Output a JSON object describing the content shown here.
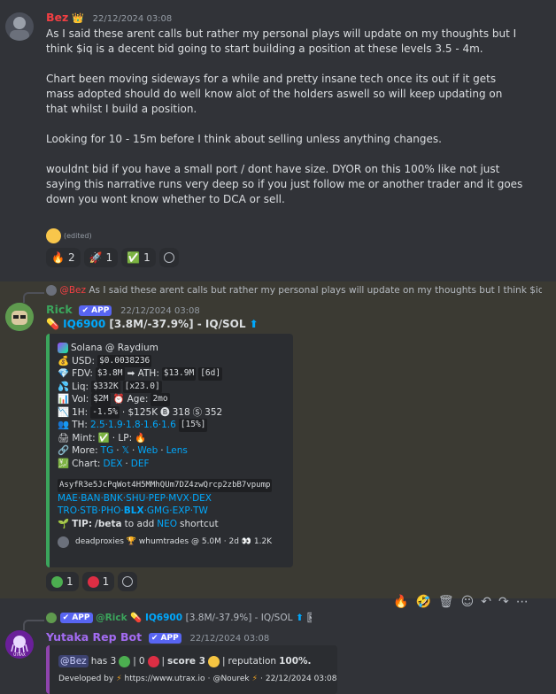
{
  "msg1": {
    "username": "Bez",
    "crown": "👑",
    "timestamp": "22/12/2024 03:08",
    "paragraphs": [
      "As I said these arent calls but rather my personal plays will update on my thoughts but I think $iq is a decent bid going to start building a position at these levels 3.5 - 4m.",
      "Chart been moving sideways for a while and pretty insane tech once its out if it gets mass adopted should do well know alot of the holders aswell so will keep updating on that whilst I build a position.",
      "Looking for 10 - 15m before I think about selling unless anything changes.",
      "wouldnt bid if you have a small port / dont have size. DYOR on this 100% like not just saying this narrative runs very deep so if you just follow me or another trader and it goes down you wont know whether to DCA or sell."
    ],
    "edited": "(edited)",
    "reactions": [
      {
        "emoji": "🔥",
        "count": "2"
      },
      {
        "emoji": "🚀",
        "count": "1"
      },
      {
        "emoji": "✅",
        "count": "1"
      }
    ]
  },
  "msg2": {
    "reply_user": "@Bez",
    "reply_text": "As I said these arent calls but rather my personal plays will update on my thoughts but I think $iq is ...",
    "username": "Rick",
    "app_tag": "✔ APP",
    "timestamp": "22/12/2024 03:08",
    "title_link": "IQ6900",
    "title_stats": "[3.8M/-37.9%]",
    "title_pair": "- IQ/SOL",
    "embed": {
      "chain": "Solana @ Raydium",
      "usd_label": "USD:",
      "usd": "$0.0038236",
      "fdv_label": "FDV:",
      "fdv": "$3.8M",
      "ath_label": "➡ ATH:",
      "ath": "$13.9M",
      "ath_age": "[6d]",
      "liq_label": "Liq:",
      "liq": "$332K",
      "liq_x": "[x23.0]",
      "vol_label": "Vol:",
      "vol": "$2M",
      "age_label": "Age:",
      "age": "2mo",
      "h1_label": "1H:",
      "h1": "-1.5%",
      "h1_vol": "· $125K",
      "h1_buys": "318",
      "h1_sells": "352",
      "th_label": "TH:",
      "th": "2.5·1.9·1.8·1.6·1.6",
      "th_pct": "[15%]",
      "mint_label": "Mint:",
      "lp_label": "· LP:",
      "more_label": "More:",
      "more_tg": "TG",
      "more_x": "𝕏",
      "more_web": "Web",
      "more_lens": "Lens",
      "chart_label": "Chart:",
      "chart_dex": "DEX",
      "chart_def": "DEF",
      "address": "AsyfR3e5JcPqWot4H5MMhQUm7DZ4zwQrcp2zbB7vpump",
      "links1": "MAE·BAN·BNK·SHU·PEP·MVX·DEX",
      "links2_a": "TRO·STB·PHO·",
      "links2_b": "BLX",
      "links2_c": "·GMG·EXP·TW",
      "tip_label": "TIP:",
      "tip_cmd": "/beta",
      "tip_mid": "to add",
      "tip_neo": "NEO",
      "tip_end": "shortcut",
      "footer": "deadproxies 🏆 whumtrades @ 5.0M · 2d 👀 1.2K"
    },
    "reactions": [
      {
        "emoji": "green-circle",
        "count": "1"
      },
      {
        "emoji": "red-circle",
        "count": "1"
      }
    ]
  },
  "msg3": {
    "reply_app": "✔ APP",
    "reply_user": "@Rick",
    "reply_link": "IQ6900",
    "reply_text": "[3.8M/-37.9%] - IQ/SOL",
    "username": "Yutaka Rep Bot",
    "app_tag": "✔ APP",
    "timestamp": "22/12/2024 03:08",
    "avatar_text": "UTRAX",
    "line1_user": "@Bez",
    "line1_has": "has 3",
    "line1_zero": "0",
    "line1_score": "score 3",
    "line1_rep": "reputation",
    "line1_pct": "100%.",
    "line2_dev": "Developed by",
    "line2_url": "https://www.utrax.io",
    "line2_author": "@Nourek",
    "line2_time": "22/12/2024 03:08"
  },
  "hover_bar": [
    "🔥",
    "🤣",
    "🗑",
    "☺",
    "↶",
    "↷",
    "⋯"
  ],
  "colors": {
    "bez_name": "#f23f43",
    "rick_name": "#3ba55c",
    "yutaka_name": "#a36bf2",
    "link": "#00a8fc",
    "highlight_bg": "#3b3a33"
  }
}
